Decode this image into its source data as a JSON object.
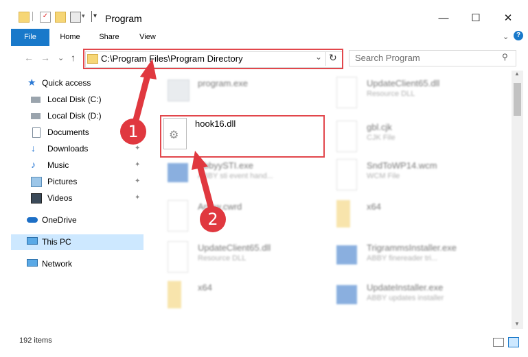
{
  "window": {
    "title": "Program",
    "minimize_glyph": "—",
    "maximize_glyph": "☐",
    "close_glyph": "✕"
  },
  "ribbon": {
    "tabs": [
      "File",
      "Home",
      "Share",
      "View"
    ]
  },
  "address": {
    "path": "C:\\Program Files\\Program Directory",
    "refresh_glyph": "↻",
    "dropdown_glyph": "⌄"
  },
  "search": {
    "placeholder": "Search Program",
    "icon": "search-icon"
  },
  "nav_buttons": {
    "back": "←",
    "forward": "→",
    "recent": "⌄",
    "up": "↑"
  },
  "sidebar": {
    "items": [
      {
        "label": "Quick access",
        "icon": "star-icon",
        "pinned": false
      },
      {
        "label": "Local Disk (C:)",
        "icon": "drive-icon",
        "pinned": false
      },
      {
        "label": "Local Disk (D:)",
        "icon": "drive-icon",
        "pinned": false
      },
      {
        "label": "Documents",
        "icon": "documents-icon",
        "pinned": true
      },
      {
        "label": "Downloads",
        "icon": "download-icon",
        "pinned": true
      },
      {
        "label": "Music",
        "icon": "music-icon",
        "pinned": true
      },
      {
        "label": "Pictures",
        "icon": "pictures-icon",
        "pinned": true
      },
      {
        "label": "Videos",
        "icon": "videos-icon",
        "pinned": true
      },
      {
        "label": "OneDrive",
        "icon": "cloud-icon",
        "pinned": false
      },
      {
        "label": "This PC",
        "icon": "computer-icon",
        "pinned": false,
        "selected": true
      },
      {
        "label": "Network",
        "icon": "network-icon",
        "pinned": false
      }
    ],
    "pin_glyph": "📌"
  },
  "files": [
    {
      "name": "program.exe",
      "desc": ""
    },
    {
      "name": "UpdateClient65.dll",
      "desc": "Resource DLL"
    },
    {
      "name": "hook16.dll",
      "desc": ""
    },
    {
      "name": "gbl.cjk",
      "desc": "CJK File"
    },
    {
      "name": "AbbyySTI.exe",
      "desc": "ABBY sti event hand..."
    },
    {
      "name": "SndToWP14.wcm",
      "desc": "WCM File"
    },
    {
      "name": "Arrow.cwrd",
      "desc": ""
    },
    {
      "name": "x64",
      "desc": ""
    },
    {
      "name": "UpdateClient65.dll",
      "desc": "Resource DLL"
    },
    {
      "name": "TrigrammsInstaller.exe",
      "desc": "ABBY finereader tri..."
    },
    {
      "name": "x64",
      "desc": ""
    },
    {
      "name": "UpdateInstaller.exe",
      "desc": "ABBY updates installer"
    }
  ],
  "status": {
    "item_count": "192 items"
  },
  "annotations": {
    "badge1": "1",
    "badge2": "2"
  },
  "colors": {
    "accent": "#1979ca",
    "annotation_red": "#e2464b"
  }
}
